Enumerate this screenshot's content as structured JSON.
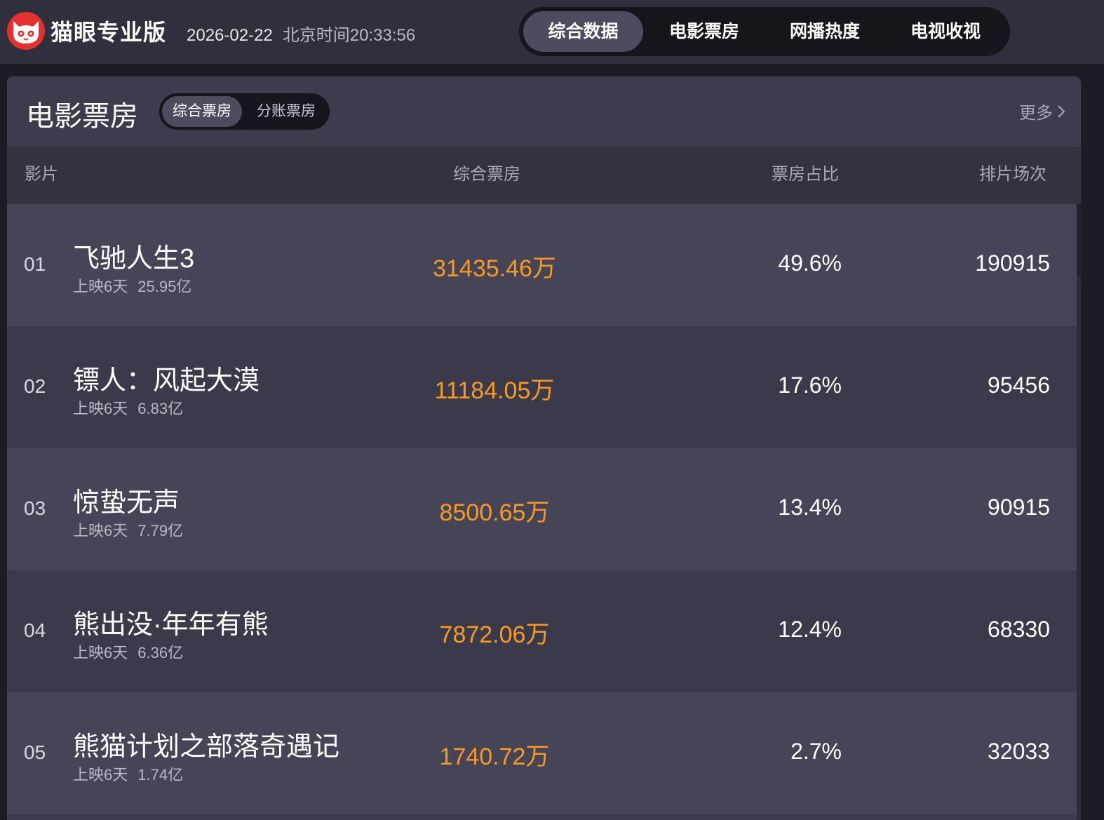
{
  "brand": {
    "name": "猫眼专业版",
    "logo_icon": "cat-face-icon",
    "logo_color": "#e2312f"
  },
  "datetime": {
    "date": "2026-02-22",
    "label": "北京时间",
    "time": "20:33:56"
  },
  "nav": {
    "tabs": [
      {
        "label": "综合数据",
        "active": true
      },
      {
        "label": "电影票房",
        "active": false
      },
      {
        "label": "网播热度",
        "active": false
      },
      {
        "label": "电视收视",
        "active": false
      }
    ]
  },
  "panel": {
    "title": "电影票房",
    "subtabs": [
      {
        "label": "综合票房",
        "active": true
      },
      {
        "label": "分账票房",
        "active": false
      }
    ],
    "more_label": "更多",
    "more_icon": "chevron-right-icon",
    "columns": [
      "影片",
      "综合票房",
      "票房占比",
      "排片场次"
    ],
    "rows": [
      {
        "rank": "01",
        "name": "飞驰人生3",
        "days": "上映6天",
        "total": "25.95亿",
        "boxoffice": "31435.46万",
        "share": "49.6%",
        "sessions": "190915"
      },
      {
        "rank": "02",
        "name": "镖人：风起大漠",
        "days": "上映6天",
        "total": "6.83亿",
        "boxoffice": "11184.05万",
        "share": "17.6%",
        "sessions": "95456"
      },
      {
        "rank": "03",
        "name": "惊蛰无声",
        "days": "上映6天",
        "total": "7.79亿",
        "boxoffice": "8500.65万",
        "share": "13.4%",
        "sessions": "90915"
      },
      {
        "rank": "04",
        "name": "熊出没·年年有熊",
        "days": "上映6天",
        "total": "6.36亿",
        "boxoffice": "7872.06万",
        "share": "12.4%",
        "sessions": "68330"
      },
      {
        "rank": "05",
        "name": "熊猫计划之部落奇遇记",
        "days": "上映6天",
        "total": "1.74亿",
        "boxoffice": "1740.72万",
        "share": "2.7%",
        "sessions": "32033"
      }
    ]
  },
  "colors": {
    "accent_orange": "#f89a22",
    "topbar_bg": "#2f2f3d",
    "panel_bg": "#3d3c4d"
  }
}
